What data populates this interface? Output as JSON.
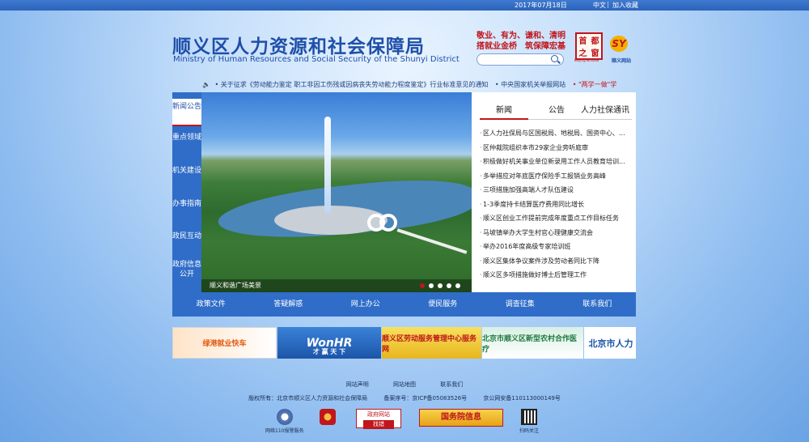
{
  "topbar": {
    "date": "2017年07月18日",
    "lang": "中文",
    "sep": "|",
    "favorite": "加入收藏"
  },
  "header": {
    "title_cn": "顺义区人力资源和社会保障局",
    "title_en": "Ministry of Human Resources and Social Security of the Shunyi District",
    "slogan_line1": "敬业、有为、谦和、清明",
    "slogan_line2": "搭就业金桥　筑保障宏基",
    "search_placeholder": "",
    "seal_chars": [
      "首",
      "都",
      "之",
      "窗"
    ],
    "seal_sub": "Beijing-window",
    "sy_logo": "SY",
    "sy_sub": "顺义网站"
  },
  "ticker": {
    "icon": "speaker-icon",
    "items": [
      "• 关于征求《劳动能力鉴定 职工非因工伤残或因病丧失劳动能力程度鉴定》行业标准意见的通知",
      "• 中央国家机关举报网站"
    ],
    "red_item": "• \"两学一做\"学"
  },
  "sidenav": [
    {
      "label": "新闻公告",
      "active": true
    },
    {
      "label": "重点领域"
    },
    {
      "label": "机关建设"
    },
    {
      "label": "办事指南"
    },
    {
      "label": "政民互动"
    },
    {
      "label": "政府信息公开"
    }
  ],
  "slideshow": {
    "caption": "顺义和谐广场美景",
    "dots": 5,
    "active_dot": 1
  },
  "news": {
    "tabs": [
      {
        "label": "新闻",
        "active": true
      },
      {
        "label": "公告"
      },
      {
        "label": "人力社保通讯"
      }
    ],
    "items": [
      "区人力社保局与区国税局、地税局、国资中心、...",
      "区仲裁院组织本市29家企业旁听庭审",
      "积极做好机关事业单位新录用工作人员教育培训...",
      "多举措应对年底医疗保险手工报销业务高峰",
      "三项措施加强高端人才队伍建设",
      "1-3季度持卡结算医疗费用同比增长",
      "顺义区创业工作提前完成年度重点工作目标任务",
      "马坡镇举办大学生村官心理健康交流会",
      "举办2016年度高级专家培训班",
      "顺义区集体争议案件涉及劳动者同比下降",
      "顺义区多项措施做好博士后管理工作"
    ]
  },
  "menubar": [
    "政策文件",
    "答疑解惑",
    "网上办公",
    "便民服务",
    "调查征集",
    "联系我们"
  ],
  "banners": {
    "b1": "绿港就业快车",
    "b2": "WonHR",
    "b2_sub": "才 赢 天 下",
    "b3": "顺义区劳动服务管理中心服务网",
    "b4": "北京市顺义区新型农村合作医疗",
    "b5": "北京市人力"
  },
  "footer": {
    "links": [
      "网站声明",
      "网站地图",
      "联系我们"
    ],
    "copyright": "版权所有：北京市顺义区人力资源和社会保障局",
    "icp": "备案序号：京ICP备05083526号",
    "police": "京公网安备110113000149号",
    "badges": {
      "b1": "网络110报警服务",
      "b3_top": "政府网站",
      "b3_bottom": "找错",
      "b4": "国务院信息",
      "b5": "扫码关注"
    }
  }
}
